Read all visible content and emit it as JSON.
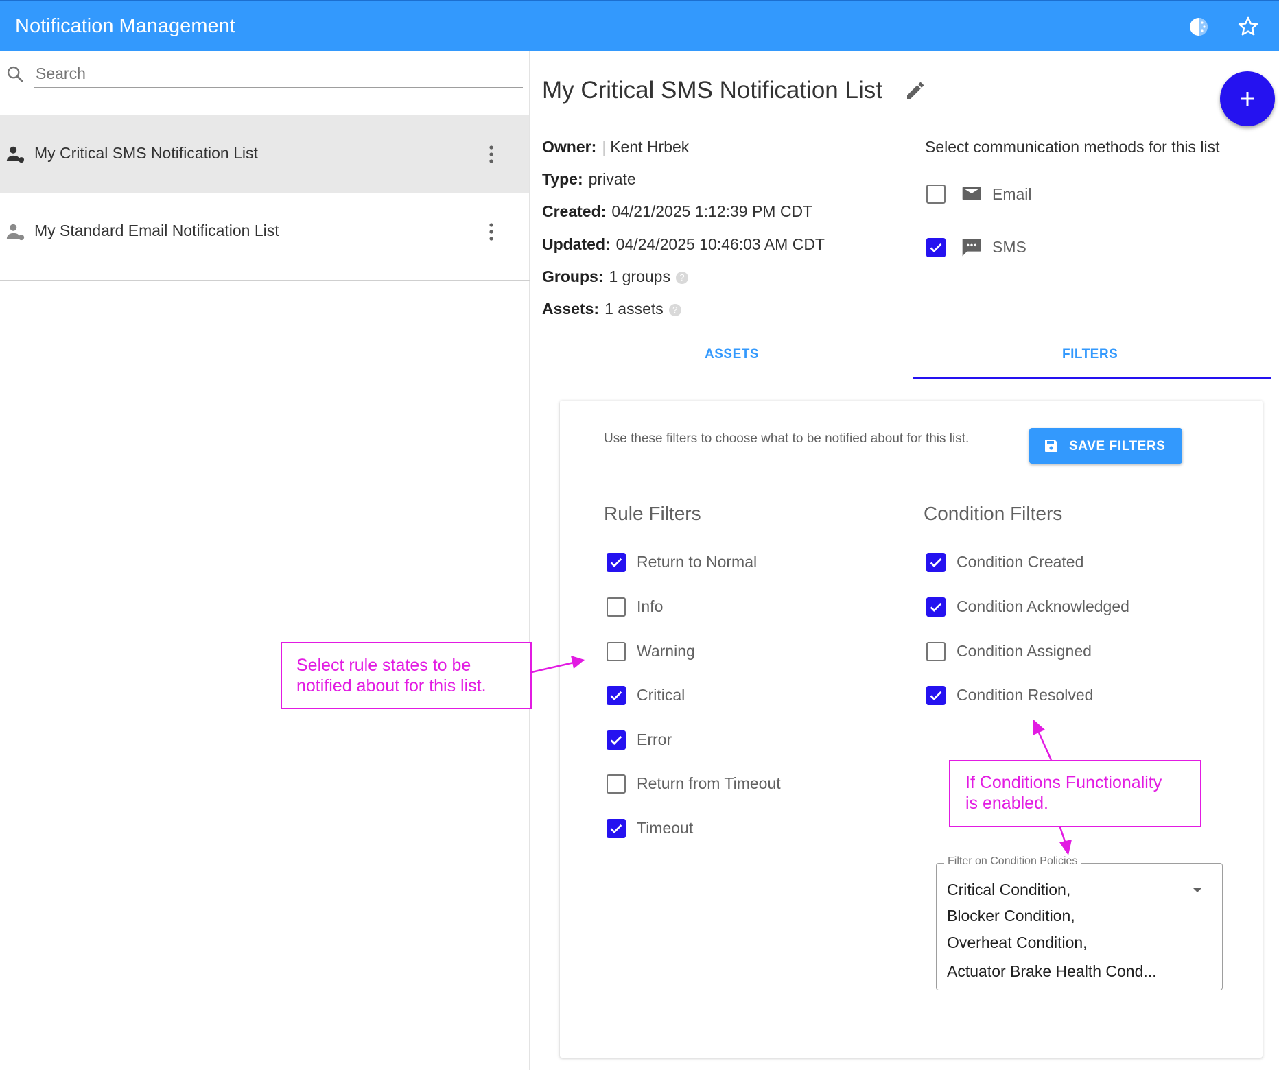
{
  "app": {
    "title": "Notification Management"
  },
  "header": {
    "icons": [
      "theme-icon",
      "star-icon"
    ]
  },
  "search": {
    "placeholder": "Search",
    "value": ""
  },
  "sidebar": {
    "items": [
      {
        "label": "My Critical SMS Notification List",
        "selected": true
      },
      {
        "label": "My Standard Email Notification List",
        "selected": false
      }
    ]
  },
  "detail": {
    "title": "My Critical SMS Notification List",
    "owner_label": "Owner:",
    "owner": "Kent Hrbek",
    "type_label": "Type:",
    "type": "private",
    "created_label": "Created:",
    "created": "04/21/2025 1:12:39 PM CDT",
    "updated_label": "Updated:",
    "updated": "04/24/2025 10:46:03 AM CDT",
    "groups_label": "Groups:",
    "groups": "1 groups",
    "assets_label": "Assets:",
    "assets": "1 assets"
  },
  "comm": {
    "title": "Select communication methods for this list",
    "methods": [
      {
        "label": "Email",
        "checked": false,
        "icon": "email-icon"
      },
      {
        "label": "SMS",
        "checked": true,
        "icon": "sms-icon"
      }
    ]
  },
  "tabs": [
    {
      "label": "ASSETS",
      "active": false
    },
    {
      "label": "FILTERS",
      "active": true
    }
  ],
  "filters": {
    "description": "Use these filters to choose what to be notified about for this list.",
    "save_label": "SAVE FILTERS",
    "rule_title": "Rule Filters",
    "rules": [
      {
        "label": "Return to Normal",
        "checked": true
      },
      {
        "label": "Info",
        "checked": false
      },
      {
        "label": "Warning",
        "checked": false
      },
      {
        "label": "Critical",
        "checked": true
      },
      {
        "label": "Error",
        "checked": true
      },
      {
        "label": "Return from Timeout",
        "checked": false
      },
      {
        "label": "Timeout",
        "checked": true
      }
    ],
    "condition_title": "Condition Filters",
    "conditions": [
      {
        "label": "Condition Created",
        "checked": true
      },
      {
        "label": "Condition Acknowledged",
        "checked": true
      },
      {
        "label": "Condition Assigned",
        "checked": false
      },
      {
        "label": "Condition Resolved",
        "checked": true
      }
    ],
    "policy": {
      "label": "Filter on Condition Policies",
      "values": [
        "Critical Condition,",
        "Blocker Condition,",
        "Overheat Condition,",
        "Actuator Brake Health Cond..."
      ]
    }
  },
  "annotations": {
    "rule_note_line1": "Select rule states to be",
    "rule_note_line2": "notified about for this list.",
    "condition_note_line1": "If Conditions Functionality",
    "condition_note_line2": "is enabled."
  },
  "colors": {
    "header": "#3399fd",
    "accent": "#2512f0",
    "annotation": "#e21be2"
  }
}
